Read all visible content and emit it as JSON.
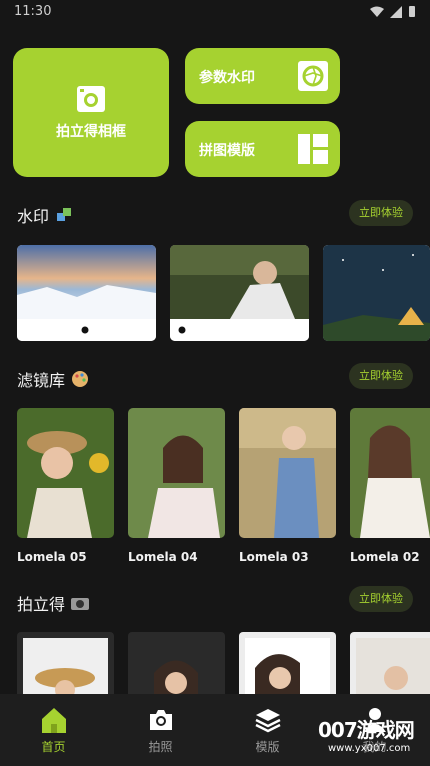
{
  "status": {
    "time": "11:30"
  },
  "tiles": {
    "instant_frame": "拍立得相框",
    "param_watermark": "参数水印",
    "collage_template": "拼图模版"
  },
  "sections": {
    "watermark": {
      "title": "水印",
      "action": "立即体验"
    },
    "filters": {
      "title": "滤镜库",
      "action": "立即体验"
    },
    "instant": {
      "title": "拍立得",
      "action": "立即体验"
    }
  },
  "filters": [
    "Lomela 05",
    "Lomela 04",
    "Lomela 03",
    "Lomela 02"
  ],
  "tabbar": {
    "home": "首页",
    "camera": "拍照",
    "template": "模版",
    "mine": "我的"
  },
  "overlay": {
    "brand": "007游戏网",
    "url": "www.yx007.com"
  },
  "colors": {
    "accent": "#a6d230",
    "background": "#161616"
  }
}
